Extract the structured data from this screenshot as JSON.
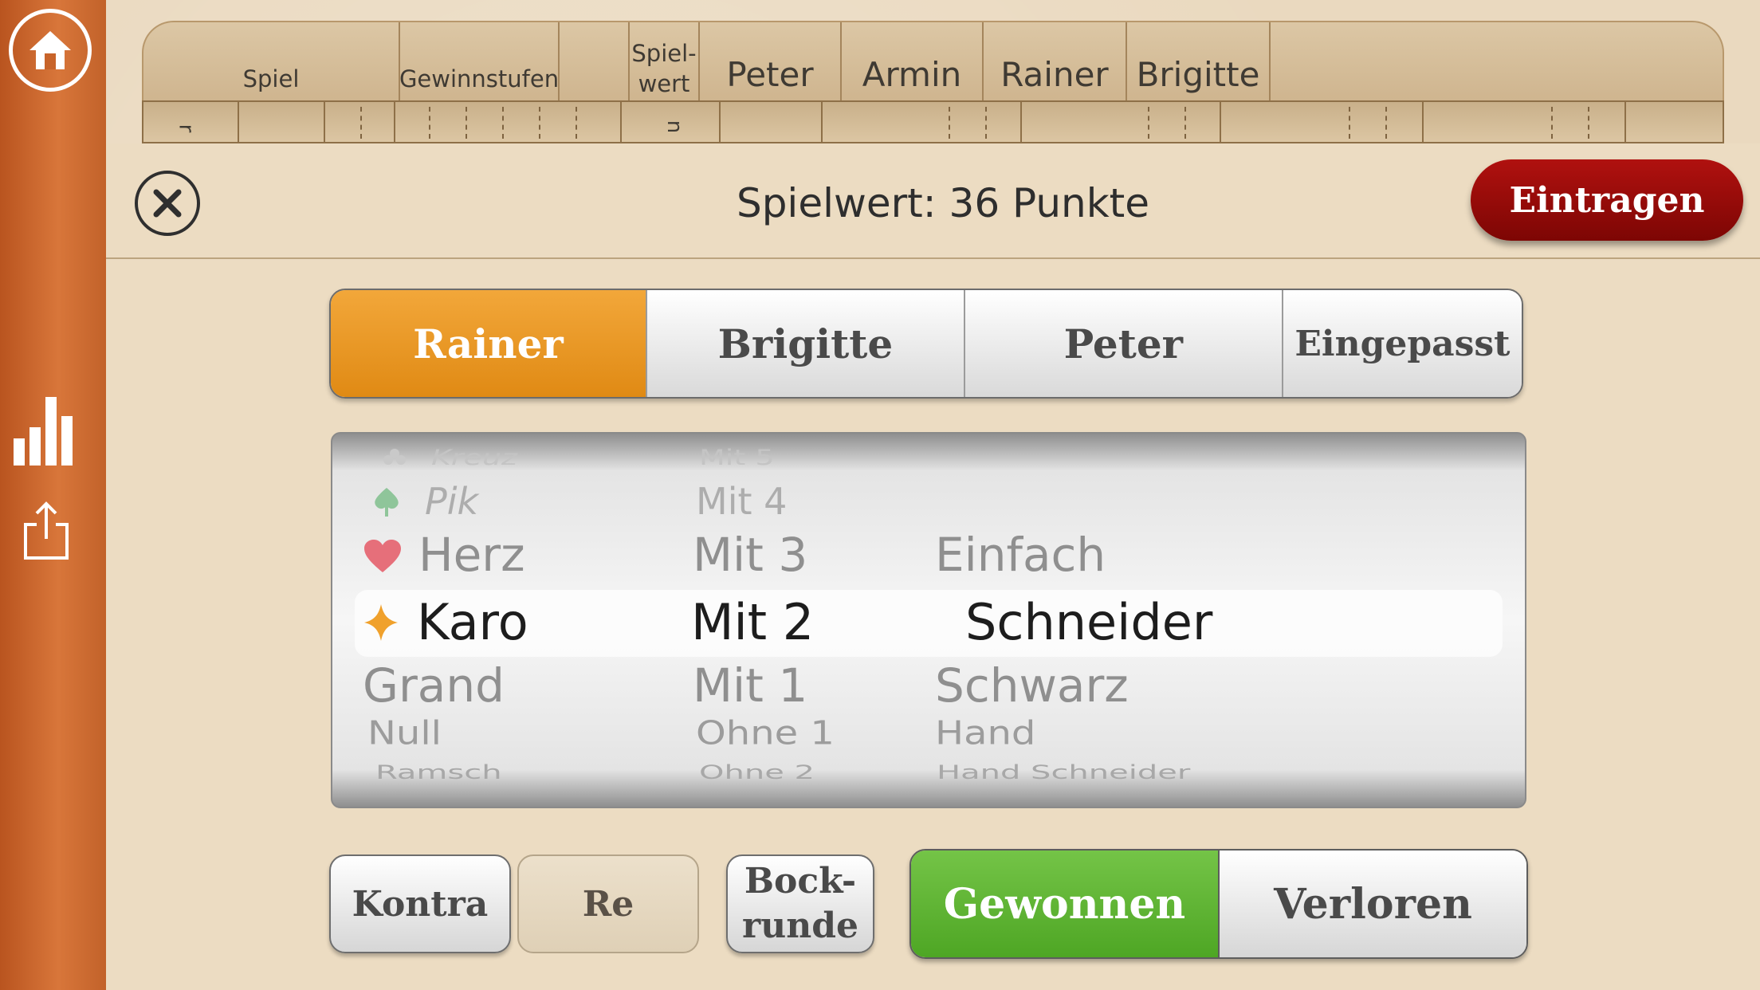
{
  "sidebar": {
    "home_icon": "home-icon",
    "stats_icon": "bar-chart-icon",
    "share_icon": "share-icon"
  },
  "score_table": {
    "columns": {
      "spiel": "Spiel",
      "gewinnstufen": "Gewinnstufen",
      "spielwert_line1": "Spiel-",
      "spielwert_line2": "wert"
    },
    "players": [
      "Peter",
      "Armin",
      "Rainer",
      "Brigitte"
    ],
    "row_fragments": [
      "r",
      "n"
    ]
  },
  "dialog": {
    "title": "Spielwert: 36 Punkte",
    "close_icon": "close-icon",
    "enter_label": "Eintragen"
  },
  "player_select": {
    "options": [
      "Rainer",
      "Brigitte",
      "Peter",
      "Eingepasst"
    ],
    "selected": "Rainer"
  },
  "picker": {
    "game_type": [
      "Kreuz",
      "Pik",
      "Herz",
      "Karo",
      "Grand",
      "Null",
      "Ramsch"
    ],
    "game_type_selected": "Karo",
    "matadors": [
      "Mit 5",
      "Mit 4",
      "Mit 3",
      "Mit 2",
      "Mit 1",
      "Ohne 1",
      "Ohne 2"
    ],
    "matadors_selected": "Mit 2",
    "level": [
      "Einfach",
      "Schneider",
      "Schwarz",
      "Hand",
      "Hand Schneider"
    ],
    "level_selected": "Schneider"
  },
  "modifiers": {
    "kontra": "Kontra",
    "re": "Re",
    "bock_line1": "Bock-",
    "bock_line2": "runde"
  },
  "result": {
    "won": "Gewonnen",
    "lost": "Verloren",
    "selected": "Gewonnen"
  },
  "colors": {
    "active_player": "#e8961f",
    "enter_button": "#9a0b08",
    "won_button": "#5fb533",
    "sidebar": "#c8642a"
  }
}
